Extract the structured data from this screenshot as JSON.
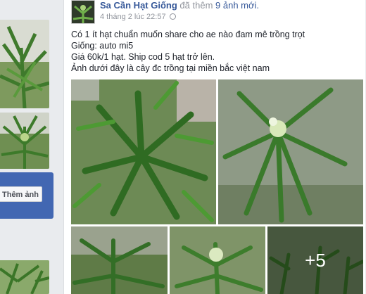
{
  "sidebar": {
    "add_photo_label": "Thêm ảnh"
  },
  "post": {
    "author": "Sa Cần Hạt Giống",
    "action": "đã thêm",
    "photo_count": "9 ảnh mới.",
    "timestamp": "4 tháng 2 lúc 22:57",
    "privacy_icon": "globe-icon",
    "lines": [
      "Có 1 ít hạt chuẩn muốn share cho ae nào đam mê trồng trọt",
      "Giống: auto mi5",
      "Giá 60k/1 hạt. Ship cod 5 hạt trở lên.",
      "Ảnh dưới đây là cây đc trồng tại miền bắc việt nam"
    ],
    "more_photos": "+5"
  },
  "colors": {
    "link": "#365899",
    "meta": "#90949c",
    "button_bg": "#4267b2",
    "page_bg": "#e9ebee"
  }
}
